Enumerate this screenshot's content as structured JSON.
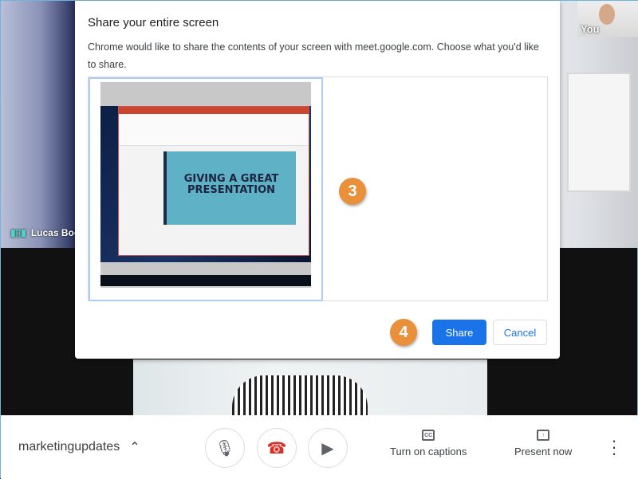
{
  "participants": {
    "lucas": "Lucas Boo",
    "self": "You"
  },
  "dialog": {
    "title": "Share your entire screen",
    "description": "Chrome would like to share the contents of your screen with meet.google.com. Choose what you'd like to share.",
    "preview_slide_title": "GIVING A GREAT PRESENTATION",
    "share_label": "Share",
    "cancel_label": "Cancel"
  },
  "callouts": {
    "step3": "3",
    "step4": "4"
  },
  "toolbar": {
    "meeting_name": "marketingupdates",
    "captions_label": "Turn on captions",
    "present_label": "Present now"
  },
  "colors": {
    "accent": "#1a73e8",
    "callout": "#e8913a",
    "hangup": "#d93025"
  }
}
